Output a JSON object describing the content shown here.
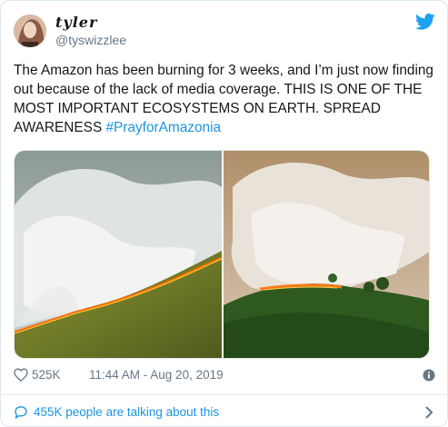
{
  "user": {
    "display_name": "tyler",
    "handle": "@tyswizzlee"
  },
  "tweet": {
    "text": "The Amazon has been burning for 3 weeks, and I’m just now finding out because of the lack of media coverage. THIS IS ONE OF THE MOST IMPORTANT ECOSYSTEMS ON EARTH. SPREAD AWARENESS ",
    "hashtag": "#PrayforAmazonia"
  },
  "meta": {
    "likes": "525K",
    "timestamp": "11:44 AM - Aug 20, 2019"
  },
  "footer": {
    "talking": "455K people are talking about this"
  },
  "icons": {
    "brand": "twitter-bird-icon",
    "like": "heart-icon",
    "info": "info-icon",
    "reply": "speech-bubble-icon",
    "chevron": "chevron-right-icon"
  },
  "colors": {
    "accent": "#1da1f2",
    "link": "#1b95e0",
    "muted": "#657786",
    "text": "#14171a"
  }
}
